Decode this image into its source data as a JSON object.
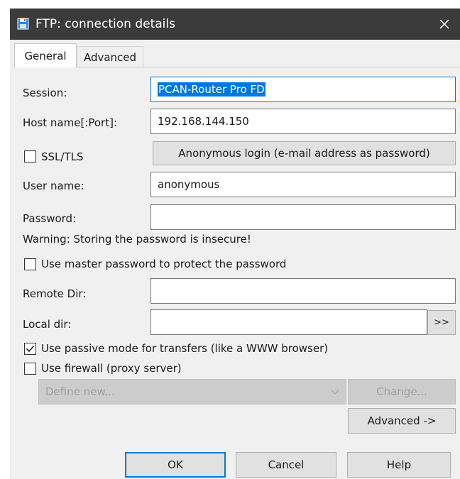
{
  "window": {
    "title": "FTP: connection details"
  },
  "tabs": [
    {
      "label": "General"
    },
    {
      "label": "Advanced"
    }
  ],
  "fields": {
    "session": {
      "label": "Session:",
      "value": "PCAN-Router Pro FD"
    },
    "host": {
      "label": "Host name[:Port]:",
      "value": "192.168.144.150"
    },
    "ssl": {
      "label": "SSL/TLS",
      "checked": false
    },
    "anonymous_button": "Anonymous login (e-mail address as password)",
    "user": {
      "label": "User name:",
      "value": "anonymous"
    },
    "password": {
      "label": "Password:",
      "value": ""
    },
    "warning": "Warning: Storing the password is insecure!",
    "master_password": {
      "label": "Use master password to protect the password",
      "checked": false
    },
    "remote_dir": {
      "label": "Remote Dir:",
      "value": ""
    },
    "local_dir": {
      "label": "Local dir:",
      "value": "",
      "browse": ">>"
    },
    "passive": {
      "label": "Use passive mode for transfers (like a WWW browser)",
      "checked": true
    },
    "firewall": {
      "label": "Use firewall (proxy server)",
      "checked": false
    },
    "proxy_select": {
      "value": "Define new..."
    },
    "change_button": "Change...",
    "advanced_button": "Advanced ->"
  },
  "footer": {
    "ok": "OK",
    "cancel": "Cancel",
    "help": "Help"
  },
  "colors": {
    "titlebar": "#3b3b3b",
    "accent": "#0078d7",
    "dialog_bg": "#f0f0f0"
  }
}
